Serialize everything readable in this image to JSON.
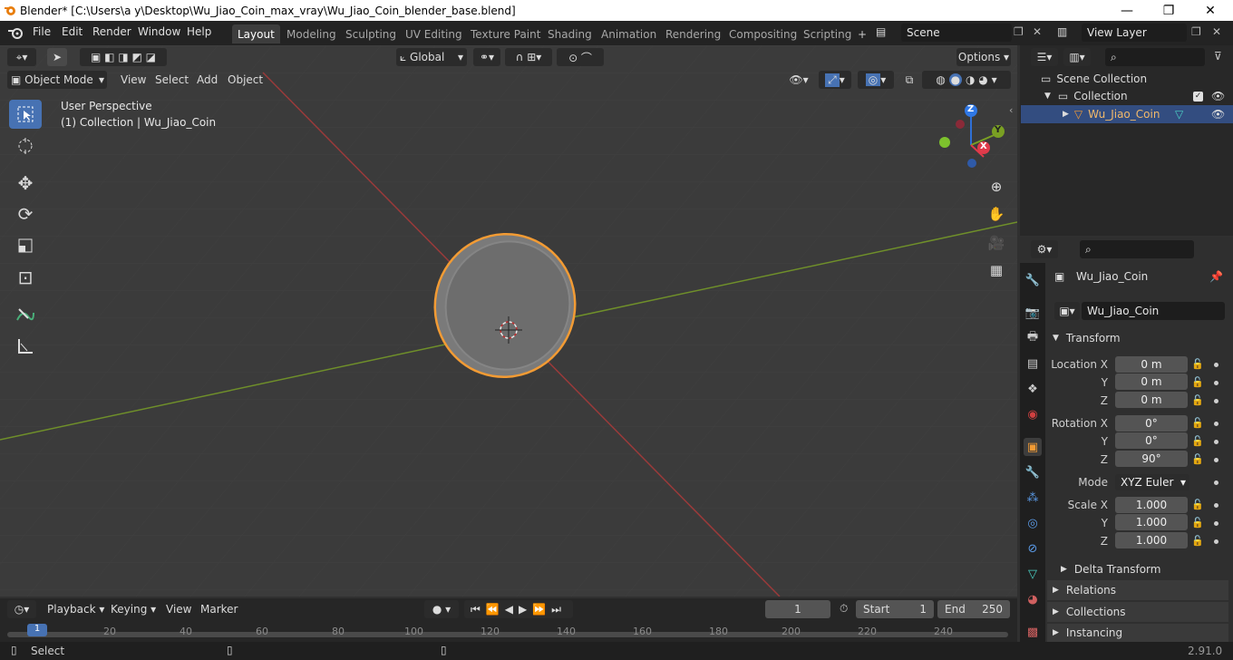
{
  "titlebar": {
    "title": "Blender* [C:\\Users\\a y\\Desktop\\Wu_Jiao_Coin_max_vray\\Wu_Jiao_Coin_blender_base.blend]",
    "minimize": "—",
    "maximize": "❐",
    "close": "✕"
  },
  "menu": {
    "items": [
      "File",
      "Edit",
      "Render",
      "Window",
      "Help"
    ]
  },
  "workspaces": [
    "Layout",
    "Modeling",
    "Sculpting",
    "UV Editing",
    "Texture Paint",
    "Shading",
    "Animation",
    "Rendering",
    "Compositing",
    "Scripting"
  ],
  "workspace_add": "+",
  "scene": {
    "name": "Scene",
    "view_layer": "View Layer"
  },
  "viewport": {
    "transform_orientation": "Global",
    "options_label": "Options",
    "mode": "Object Mode",
    "menus": [
      "View",
      "Select",
      "Add",
      "Object"
    ],
    "overlay_text_1": "User Perspective",
    "overlay_text_2": "(1) Collection | Wu_Jiao_Coin",
    "gizmo": {
      "z": "Z",
      "y": "Y",
      "x": "X"
    }
  },
  "outliner": {
    "scene_collection": "Scene Collection",
    "collection": "Collection",
    "object": "Wu_Jiao_Coin"
  },
  "properties": {
    "object_name": "Wu_Jiao_Coin",
    "object_field": "Wu_Jiao_Coin",
    "transform_header": "Transform",
    "location_label": "Location X",
    "location": [
      "0 m",
      "0 m",
      "0 m"
    ],
    "rotation_label": "Rotation X",
    "rotation": [
      "0°",
      "0°",
      "90°"
    ],
    "y_label": "Y",
    "z_label": "Z",
    "mode_label": "Mode",
    "mode_value": "XYZ Euler",
    "scale_label": "Scale X",
    "scale": [
      "1.000",
      "1.000",
      "1.000"
    ],
    "delta_transform": "Delta Transform",
    "relations": "Relations",
    "collections": "Collections",
    "instancing": "Instancing"
  },
  "timeline": {
    "menus": [
      "Playback",
      "Keying",
      "View",
      "Marker"
    ],
    "current_frame": "1",
    "start_label": "Start",
    "start": "1",
    "end_label": "End",
    "end": "250",
    "ticks": [
      "1",
      "20",
      "40",
      "60",
      "80",
      "100",
      "120",
      "140",
      "160",
      "180",
      "200",
      "220",
      "240"
    ]
  },
  "status": {
    "left": "Select",
    "version": "2.91.0"
  },
  "colors": {
    "accent": "#4772b3",
    "selection": "#f29b34",
    "x_axis": "#8a3030",
    "y_axis": "#6b8a2a"
  }
}
